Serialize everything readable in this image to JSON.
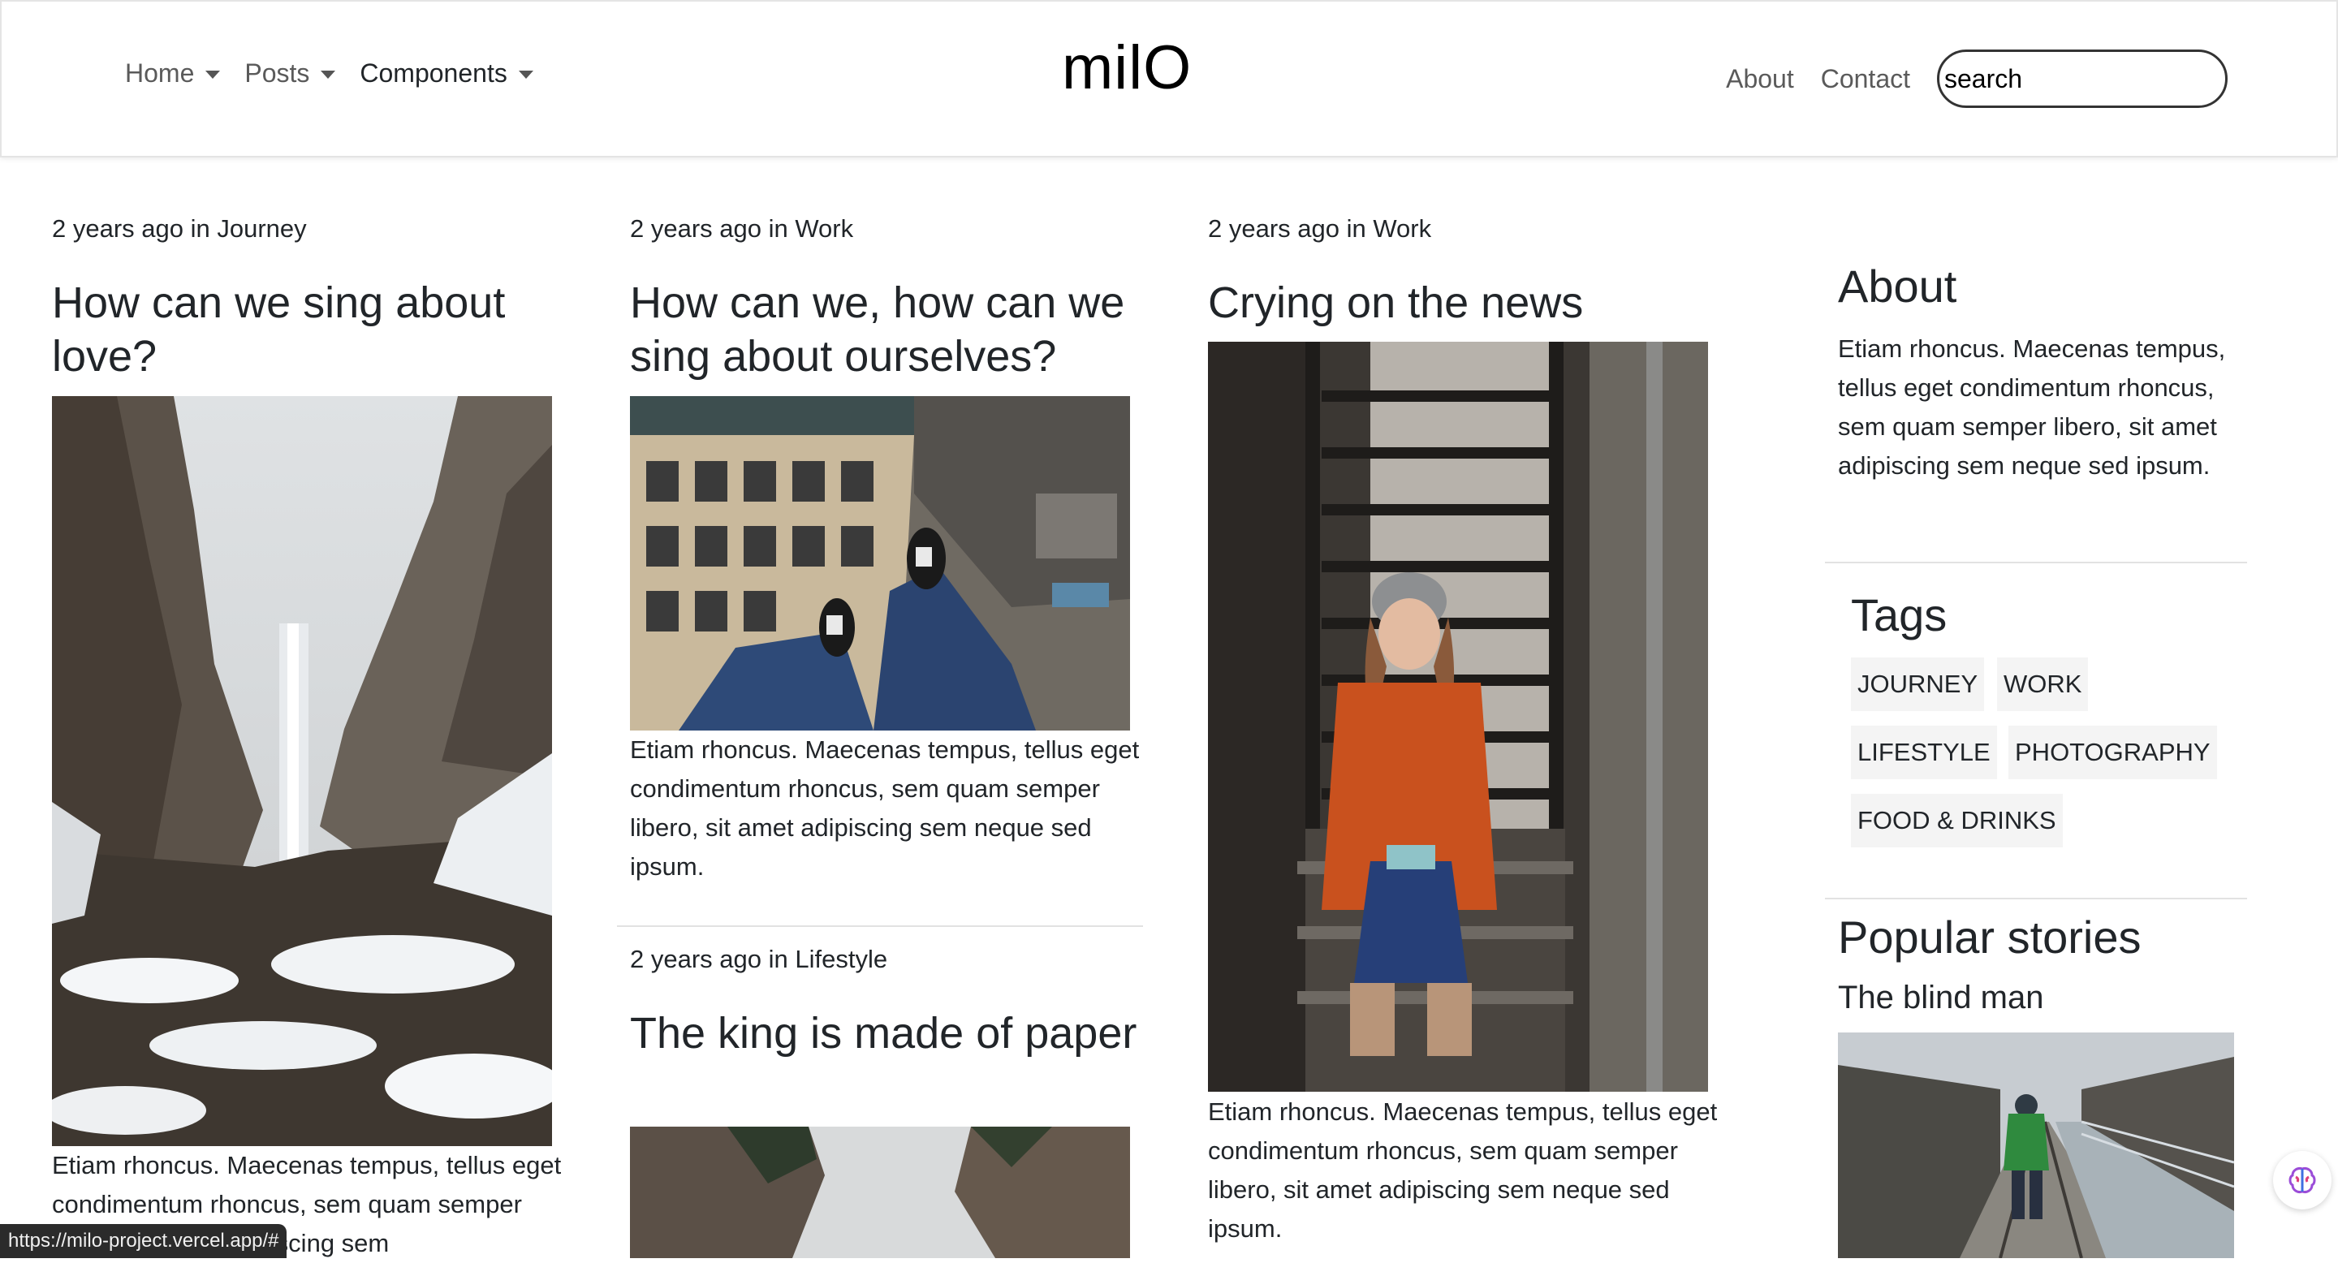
{
  "header": {
    "logo": "milO",
    "nav_left": [
      {
        "label": "Home"
      },
      {
        "label": "Posts"
      },
      {
        "label": "Components"
      }
    ],
    "nav_right": [
      {
        "label": "About"
      },
      {
        "label": "Contact"
      }
    ],
    "search_value": "search"
  },
  "posts": [
    {
      "meta": "2 years ago in Journey",
      "title": "How can we sing about love?",
      "excerpt": "Etiam rhoncus. Maecenas tempus, tellus eget condimentum rhoncus, sem quam semper libero, sit amet adipiscing sem",
      "image": "waterfall-canyon-snow"
    },
    {
      "meta": "2 years ago in Work",
      "title": "How can we, how can we sing about ourselves?",
      "excerpt": "Etiam rhoncus. Maecenas tempus, tellus eget condimentum rhoncus, sem quam semper libero, sit amet adipiscing sem neque sed ipsum.",
      "image": "feet-over-city-buildings"
    },
    {
      "meta": "2 years ago in Lifestyle",
      "title": "The king is made of paper",
      "image": "canyon-snow"
    },
    {
      "meta": "2 years ago in Work",
      "title": "Crying on the news",
      "excerpt": "Etiam rhoncus. Maecenas tempus, tellus eget condimentum rhoncus, sem quam semper libero, sit amet adipiscing sem neque sed ipsum.",
      "image": "woman-on-fire-escape-stairs"
    }
  ],
  "sidebar": {
    "about_heading": "About",
    "about_text": "Etiam rhoncus. Maecenas tempus, tellus eget condimentum rhoncus, sem quam semper libero, sit amet adipiscing sem neque sed ipsum.",
    "tags_heading": "Tags",
    "tags": [
      "JOURNEY",
      "WORK",
      "LIFESTYLE",
      "PHOTOGRAPHY",
      "FOOD & DRINKS"
    ],
    "popular_heading": "Popular stories",
    "popular": [
      {
        "title": "The blind man",
        "image": "man-on-railway-bridge"
      }
    ]
  },
  "statusbar": {
    "url": "https://milo-project.vercel.app/#"
  },
  "icons": {
    "extension": "brain-icon"
  }
}
